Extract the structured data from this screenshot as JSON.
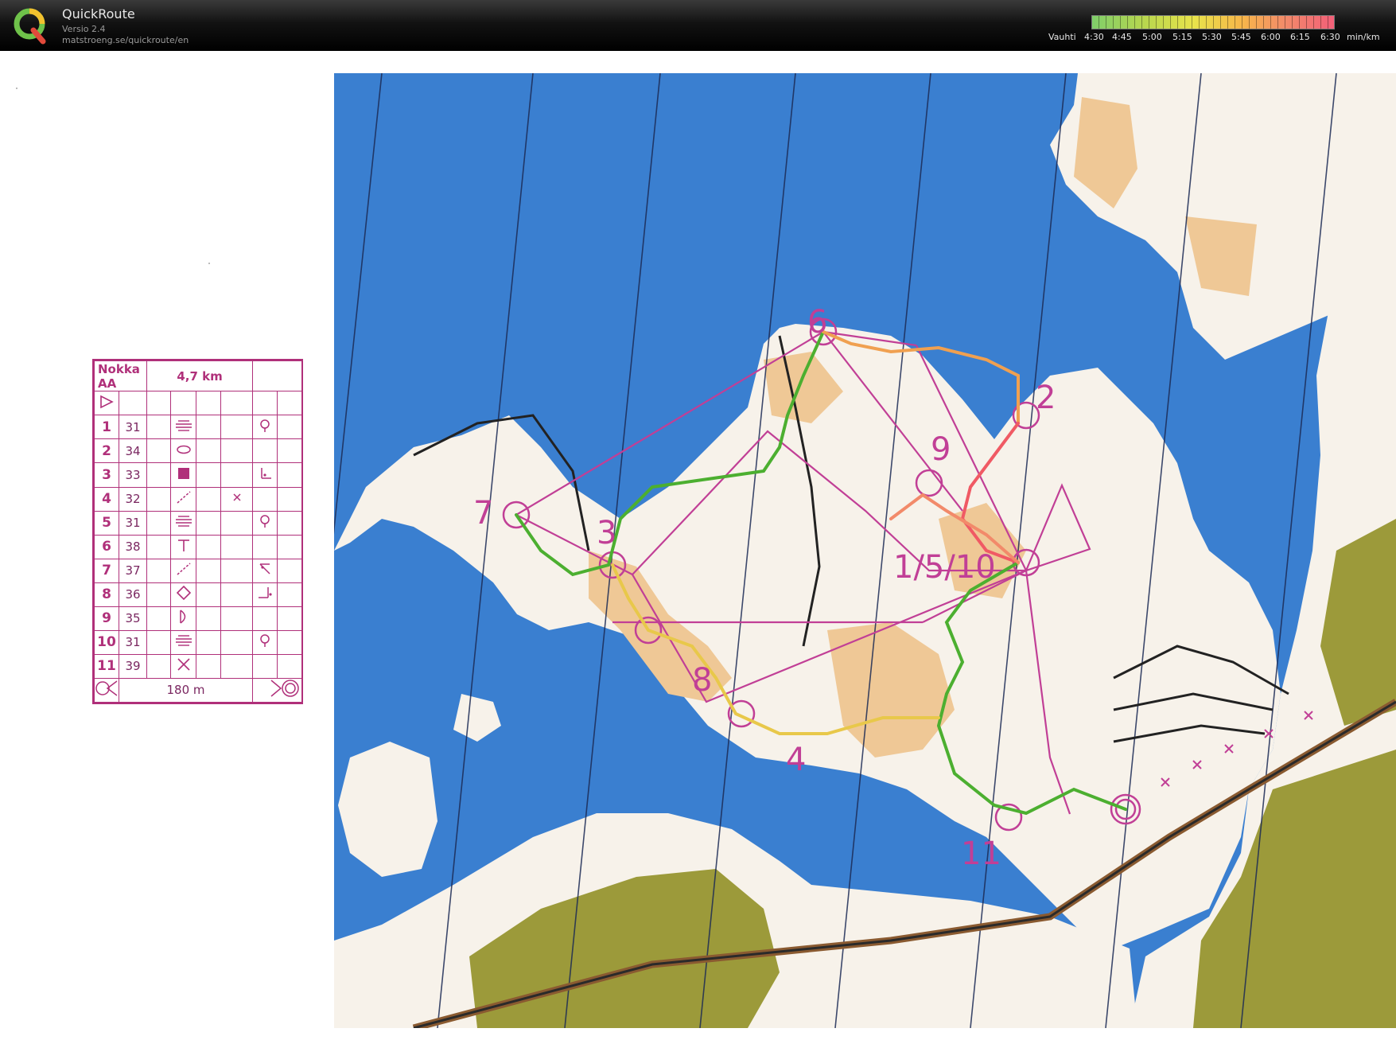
{
  "app": {
    "name": "QuickRoute",
    "version": "Versio 2.4",
    "url": "matstroeng.se/quickroute/en"
  },
  "pace_scale": {
    "label": "Vauhti",
    "ticks": [
      "4:30",
      "4:45",
      "5:00",
      "5:15",
      "5:30",
      "5:45",
      "6:00",
      "6:15",
      "6:30"
    ],
    "unit": "min/km",
    "colors": [
      "#7fce6a",
      "#b9d64e",
      "#e8e34b",
      "#f7b64a",
      "#f28a6a",
      "#f25f78"
    ]
  },
  "course_card": {
    "name": "Nokka AA",
    "length": "4,7 km",
    "controls": [
      {
        "num": "1",
        "code": "31",
        "feature": "terraces-icon",
        "detail": "",
        "extra": "waterhole-icon"
      },
      {
        "num": "2",
        "code": "34",
        "feature": "knoll-icon",
        "detail": "",
        "extra": ""
      },
      {
        "num": "3",
        "code": "33",
        "feature": "boulder-icon",
        "detail": "",
        "extra": "foot-corner-icon"
      },
      {
        "num": "4",
        "code": "32",
        "feature": "gully-icon",
        "detail": "crossing-icon",
        "extra": ""
      },
      {
        "num": "5",
        "code": "31",
        "feature": "terraces-icon",
        "detail": "",
        "extra": "waterhole-icon"
      },
      {
        "num": "6",
        "code": "38",
        "feature": "path-end-icon",
        "detail": "",
        "extra": ""
      },
      {
        "num": "7",
        "code": "37",
        "feature": "gully-icon",
        "detail": "",
        "extra": "top-corner-icon"
      },
      {
        "num": "8",
        "code": "36",
        "feature": "diamond-icon",
        "detail": "",
        "extra": "foot-corner-icon"
      },
      {
        "num": "9",
        "code": "35",
        "feature": "cliff-icon",
        "detail": "",
        "extra": ""
      },
      {
        "num": "10",
        "code": "31",
        "feature": "terraces-icon",
        "detail": "",
        "extra": "waterhole-icon"
      },
      {
        "num": "11",
        "code": "39",
        "feature": "cross-icon",
        "detail": "",
        "extra": ""
      }
    ],
    "finish_distance": "180 m"
  },
  "map": {
    "colors": {
      "water": "#3a7fd0",
      "land": "#f7f2ea",
      "open": "#efc896",
      "urban": "#9c9a3a",
      "course": "#c13f96",
      "route_fast": "#4caf30",
      "route_slow": "#f05a64"
    },
    "control_labels": [
      "6",
      "2",
      "9",
      "7",
      "3",
      "1/5/10",
      "8",
      "4",
      "11"
    ]
  }
}
